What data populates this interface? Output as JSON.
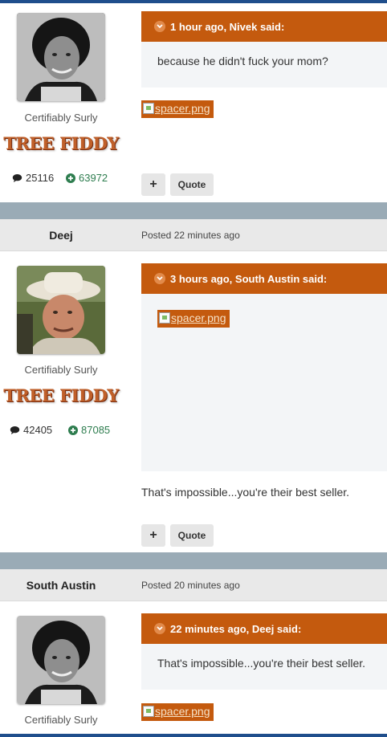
{
  "posts": [
    {
      "user_title": "Certifiably Surly",
      "badge": "TREE FIDDY",
      "post_count": "25116",
      "reputation": "63972",
      "quote": {
        "header": "1 hour ago, Nivek said:",
        "body": "because he didn't fuck your mom?"
      },
      "image_alt": "spacer.png",
      "buttons": {
        "plus": "+",
        "quote": "Quote"
      }
    },
    {
      "author": "Deej",
      "posted": "Posted 22 minutes ago",
      "user_title": "Certifiably Surly",
      "badge": "TREE FIDDY",
      "post_count": "42405",
      "reputation": "87085",
      "quote": {
        "header": "3 hours ago, South Austin said:",
        "image_alt": "spacer.png"
      },
      "text": "That's impossible...you're their best seller.",
      "buttons": {
        "plus": "+",
        "quote": "Quote"
      }
    },
    {
      "author": "South Austin",
      "posted": "Posted 20 minutes ago",
      "user_title": "Certifiably Surly",
      "quote": {
        "header": "22 minutes ago, Deej said:",
        "body": "That's impossible...you're their best seller."
      },
      "image_alt": "spacer.png"
    }
  ],
  "colors": {
    "accent": "#c45a0e",
    "divider": "#9aabb6",
    "topbar": "#1f4e8c",
    "rep_green": "#2e7d4f"
  },
  "icons": [
    "chevron-down-icon",
    "comment-icon",
    "plus-circle-icon",
    "broken-image-icon"
  ]
}
